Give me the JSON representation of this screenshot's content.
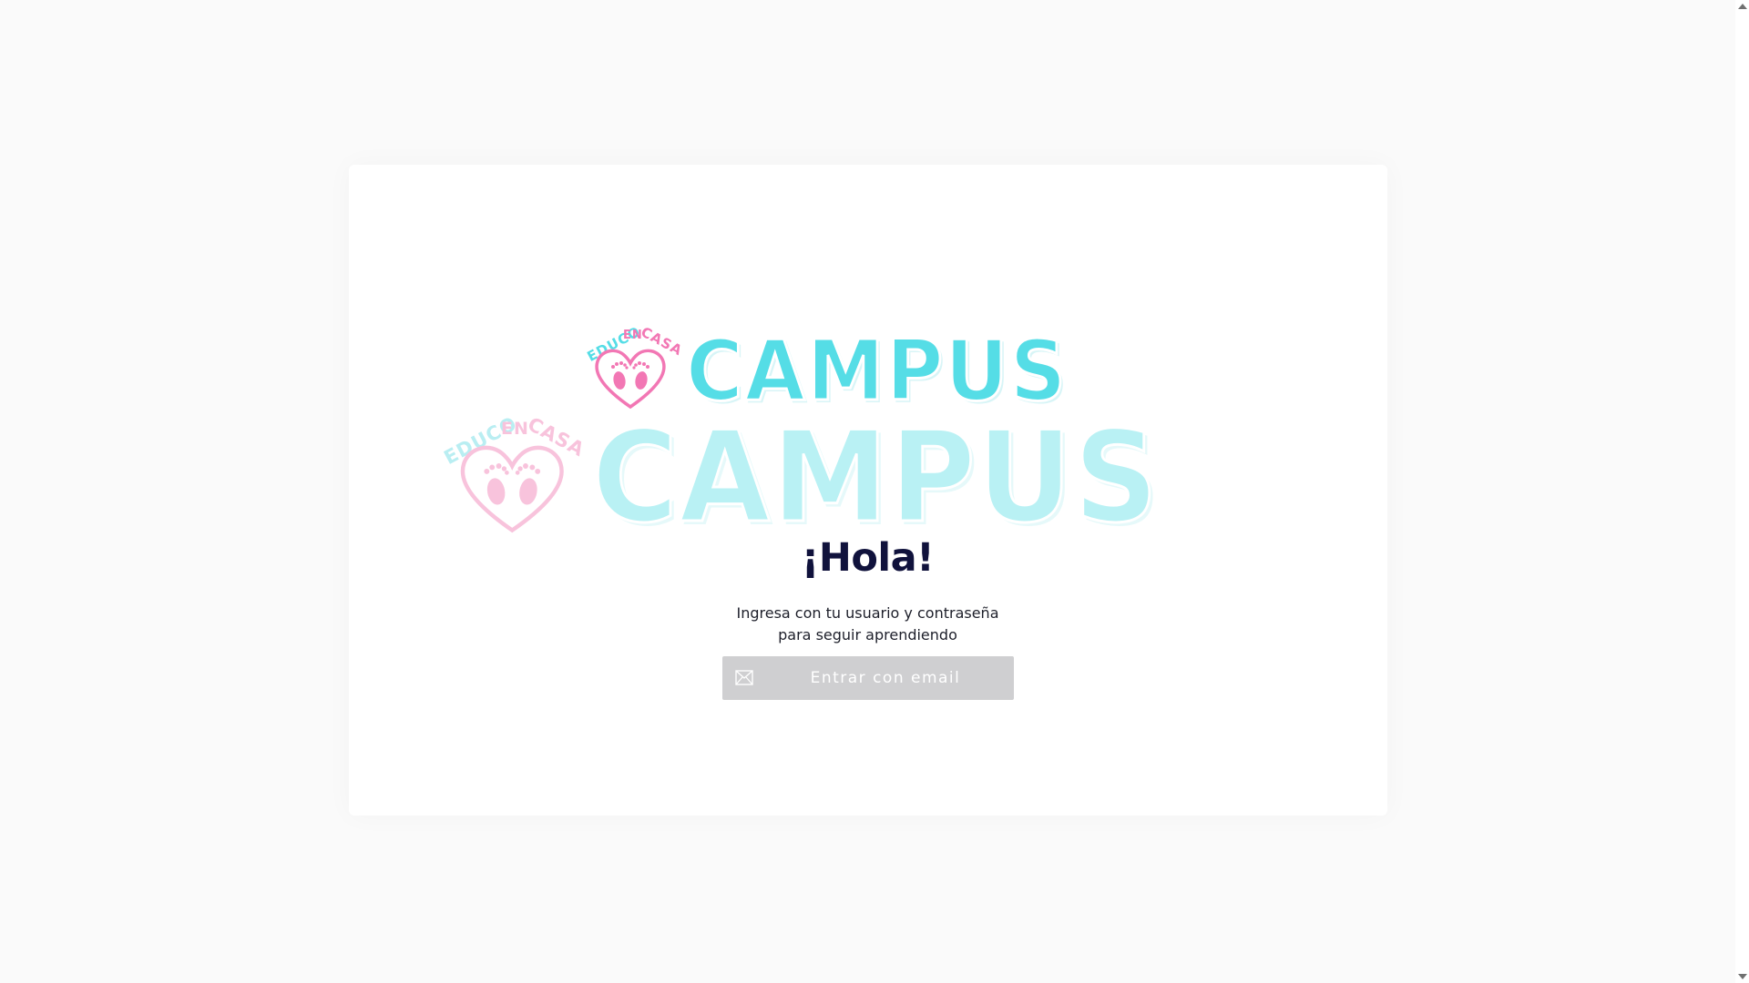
{
  "brand": {
    "logo_top_text": "EDUCO EN CASA",
    "logo_educo": "EDUCO",
    "logo_en": "EN",
    "logo_casa": "CASA",
    "logo_word": "CAMPUS",
    "colors": {
      "turquoise": "#55dde6",
      "turquoise_faded": "#b9f1f4",
      "pink": "#f277b4",
      "pink_faded": "#f8c3dc"
    }
  },
  "login": {
    "greeting": "¡Hola!",
    "subtitle": "Ingresa con tu usuario y contraseña para seguir aprendiendo",
    "email_button_label": "Entrar con email",
    "email_button_icon": "mail-icon",
    "email_button_color": "#cfcfd1"
  }
}
